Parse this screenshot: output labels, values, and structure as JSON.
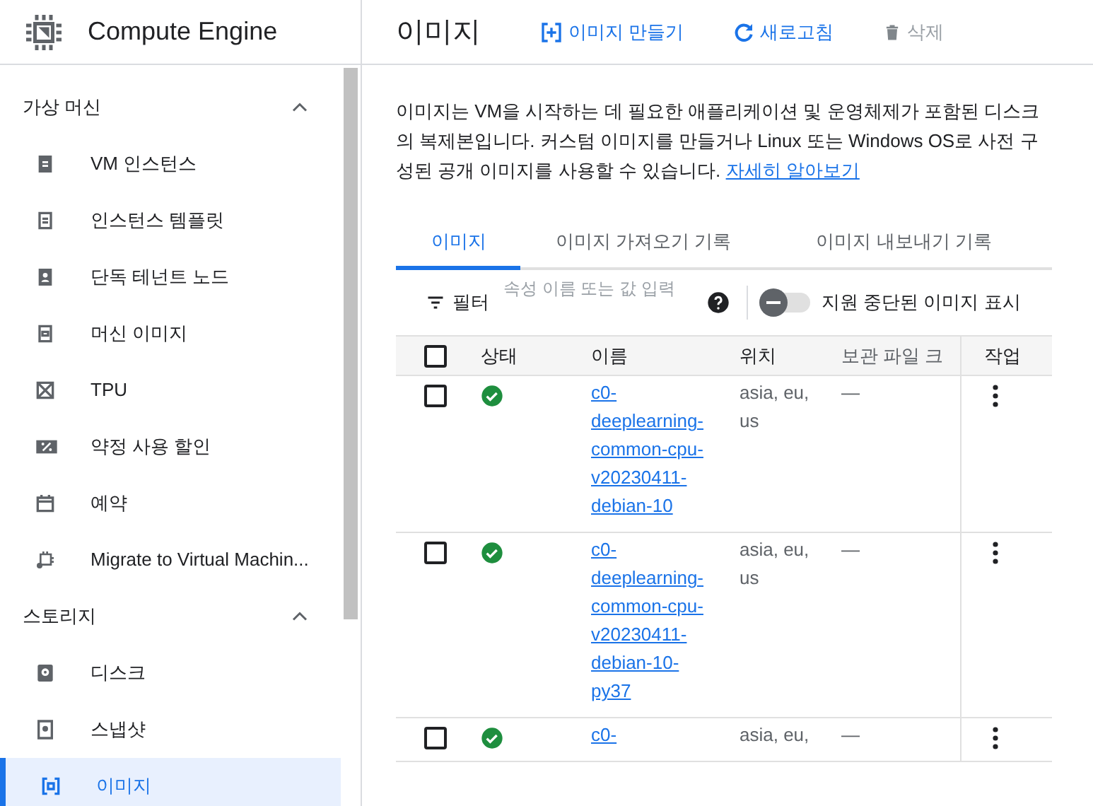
{
  "app": {
    "title": "Compute Engine"
  },
  "sidebar": {
    "sections": [
      {
        "title": "가상 머신",
        "expanded": true,
        "items": [
          {
            "label": "VM 인스턴스",
            "selected": false
          },
          {
            "label": "인스턴스 템플릿",
            "selected": false
          },
          {
            "label": "단독 테넌트 노드",
            "selected": false
          },
          {
            "label": "머신 이미지",
            "selected": false
          },
          {
            "label": "TPU",
            "selected": false
          },
          {
            "label": "약정 사용 할인",
            "selected": false
          },
          {
            "label": "예약",
            "selected": false
          },
          {
            "label": "Migrate to Virtual Machin...",
            "selected": false
          }
        ]
      },
      {
        "title": "스토리지",
        "expanded": true,
        "items": [
          {
            "label": "디스크",
            "selected": false
          },
          {
            "label": "스냅샷",
            "selected": false
          },
          {
            "label": "이미지",
            "selected": true
          }
        ]
      }
    ]
  },
  "page": {
    "title": "이미지",
    "actions": [
      {
        "label": "이미지 만들기",
        "kind": "create",
        "disabled": false
      },
      {
        "label": "새로고침",
        "kind": "refresh",
        "disabled": false
      },
      {
        "label": "삭제",
        "kind": "delete",
        "disabled": true
      }
    ],
    "description": "이미지는 VM을 시작하는 데 필요한 애플리케이션 및 운영체제가 포함된 디스크의 복제본입니다. 커스텀 이미지를 만들거나 Linux 또는 Windows OS로 사전 구성된 공개 이미지를 사용할 수 있습니다.",
    "learn_more": "자세히 알아보기"
  },
  "tabs": [
    {
      "label": "이미지",
      "selected": true
    },
    {
      "label": "이미지 가져오기 기록",
      "selected": false
    },
    {
      "label": "이미지 내보내기 기록",
      "selected": false
    }
  ],
  "filter": {
    "label": "필터",
    "placeholder": "속성 이름 또는 값 입력"
  },
  "deprecated_toggle": {
    "label": "지원 중단된 이미지 표시",
    "on": false
  },
  "table": {
    "select_all_checked": false,
    "columns": [
      "상태",
      "이름",
      "위치",
      "보관 파일 크",
      "작업"
    ],
    "rows": [
      {
        "checked": false,
        "ready": true,
        "name": "c0-deeplearning-common-cpu-v20230411-debian-10",
        "location": "asia, eu, us",
        "archive_size": "—"
      },
      {
        "checked": false,
        "ready": true,
        "name": "c0-deeplearning-common-cpu-v20230411-debian-10-py37",
        "location": "asia, eu, us",
        "archive_size": "—"
      },
      {
        "checked": false,
        "ready": true,
        "name": "c0-",
        "location": "asia, eu,",
        "archive_size": "—"
      }
    ]
  }
}
